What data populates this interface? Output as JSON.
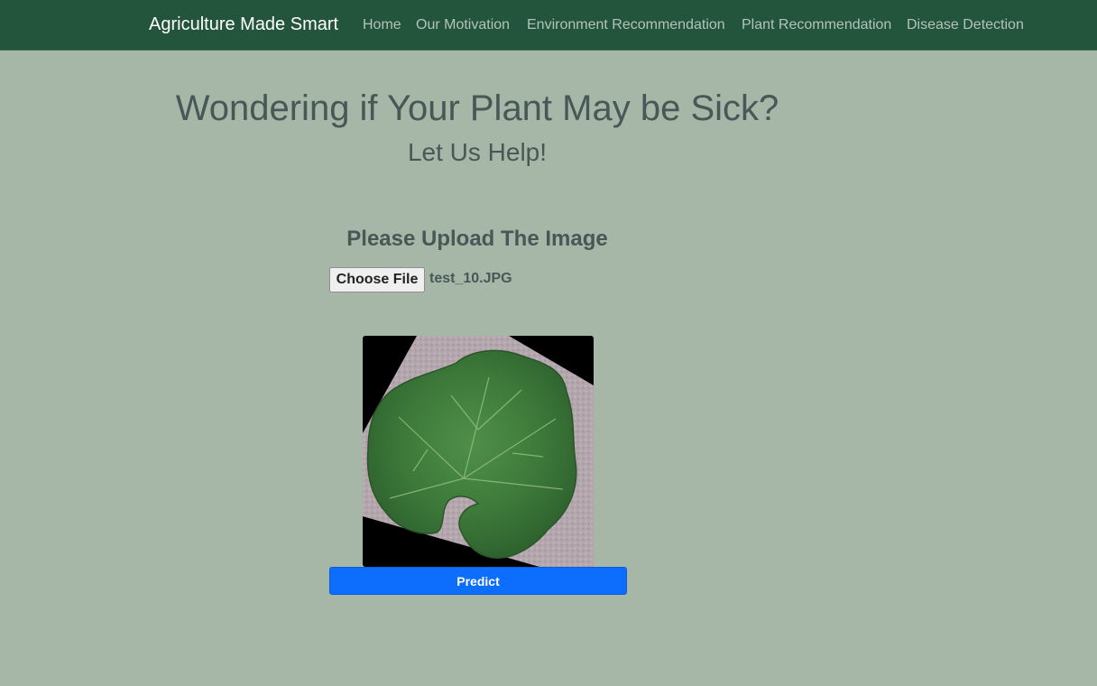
{
  "navbar": {
    "brand": "Agriculture Made Smart",
    "links": [
      {
        "label": "Home"
      },
      {
        "label": "Our Motivation"
      },
      {
        "label": "Environment Recommendation"
      },
      {
        "label": "Plant Recommendation"
      },
      {
        "label": "Disease Detection"
      }
    ]
  },
  "hero": {
    "title": "Wondering if Your Plant May be Sick?",
    "subtitle": "Let Us Help!"
  },
  "upload": {
    "heading": "Please Upload The Image",
    "choose_file_label": "Choose File",
    "file_name": "test_10.JPG",
    "predict_label": "Predict"
  },
  "colors": {
    "navbar_bg": "#23543c",
    "page_bg": "#a6b6a7",
    "text": "#475857",
    "predict_bg": "#0d6efd"
  }
}
